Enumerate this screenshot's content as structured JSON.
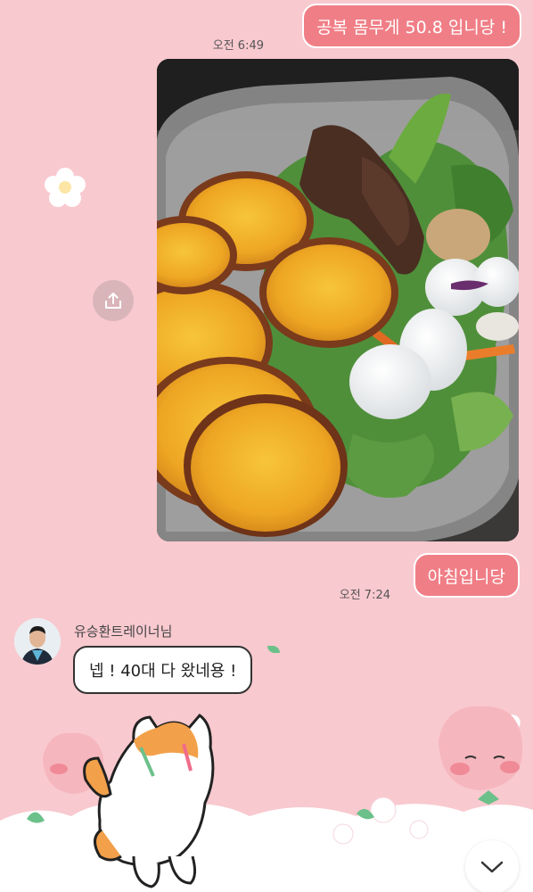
{
  "messages": {
    "sent_1": {
      "text": "공복 몸무게 50.8 입니당 !",
      "time": "오전 6:49"
    },
    "sent_2": {
      "text": "아침입니당",
      "time": "오전 7:24"
    },
    "received_1": {
      "sender": "유승환트레이너님",
      "text": "넵 ! 40대 다 왔네용 !"
    }
  },
  "icons": {
    "share": "share-icon",
    "scroll_down": "chevron-down-icon"
  },
  "colors": {
    "background": "#f8c9cf",
    "sent_bubble": "#f07e86",
    "received_bubble": "#ffffff"
  }
}
